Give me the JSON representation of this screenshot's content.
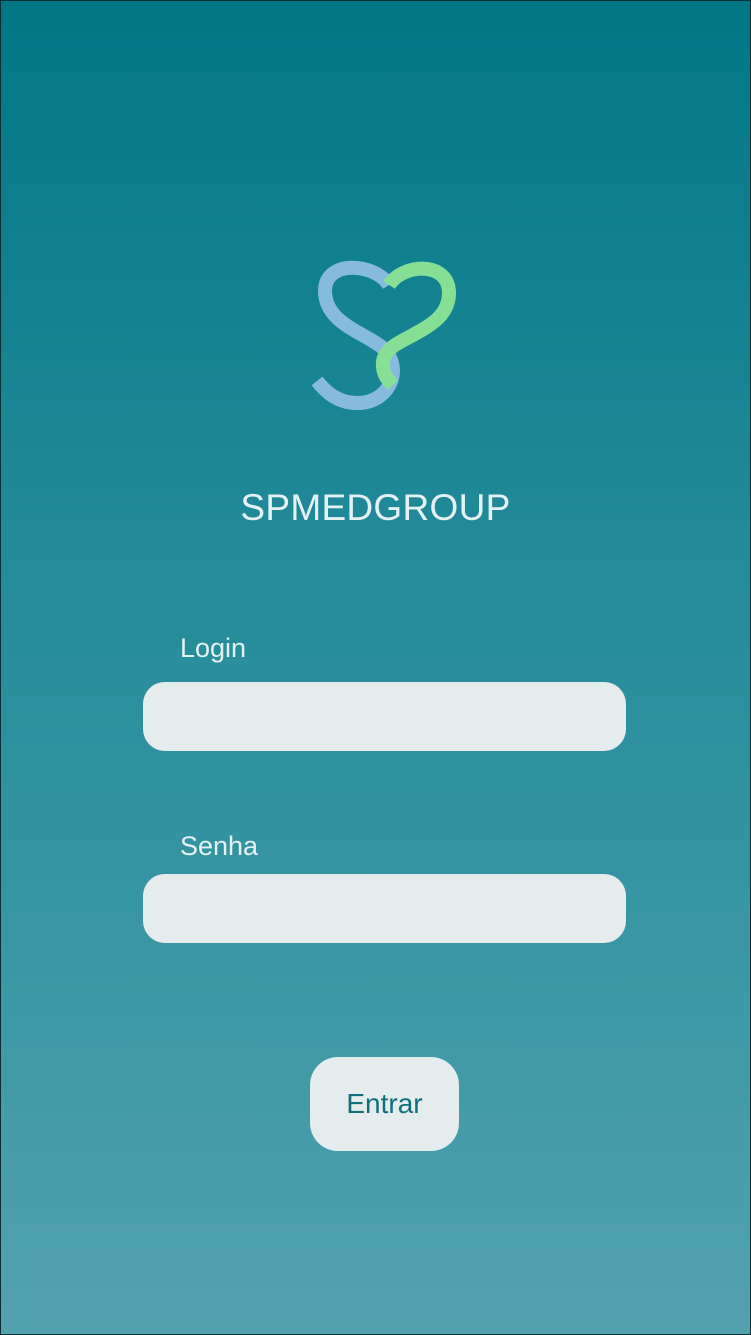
{
  "app": {
    "brand_name": "SPMEDGROUP",
    "logo_icon": "heart-s-logo-icon"
  },
  "form": {
    "login_label": "Login",
    "login_value": "",
    "senha_label": "Senha",
    "senha_value": "",
    "submit_label": "Entrar"
  },
  "colors": {
    "background_top": "#017786",
    "background_bottom": "#52a2ae",
    "field_background": "#e4eced",
    "logo_blue": "#86bbdf",
    "logo_green": "#86df95",
    "text_light": "#e3f2f4",
    "button_text": "#0f6f7d"
  }
}
